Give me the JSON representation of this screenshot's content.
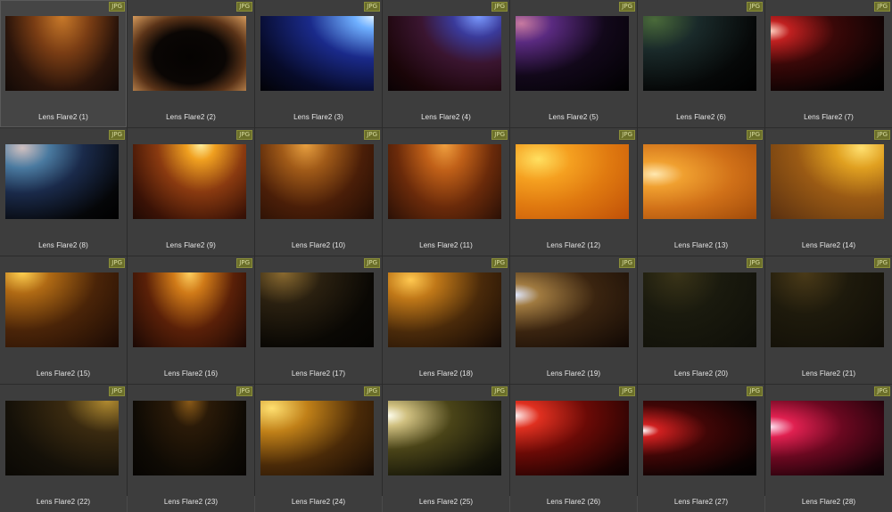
{
  "file_type_badge": "JPG",
  "items": [
    {
      "label": "Lens Flare2 (1)",
      "bg": "radial-gradient(ellipse at 50% 0%, #c97a2a 0%, #7a3d14 35%, #2a140a 70%, #120906 100%)"
    },
    {
      "label": "Lens Flare2 (2)",
      "bg": "radial-gradient(ellipse at 50% 55%, #050302 0%, #0a0604 45%, #5a3318 70%, #d59a5c 100%)"
    },
    {
      "label": "Lens Flare2 (3)",
      "bg": "radial-gradient(ellipse at 100% 0%, #dff0ff 0%, #6fb0ff 12%, #1a2a8a 40%, #070b2a 75%, #020206 100%)"
    },
    {
      "label": "Lens Flare2 (4)",
      "bg": "radial-gradient(ellipse at 80% 0%, #7a9aff 0%, #3a3a9a 20%, #3a1530 45%, #1a0508 80%, #0a0204 100%)"
    },
    {
      "label": "Lens Flare2 (5)",
      "bg": "radial-gradient(ellipse at 5% 10%, #c87aa0 0%, #5a2a80 20%, #12081a 55%, #000 100%)"
    },
    {
      "label": "Lens Flare2 (6)",
      "bg": "radial-gradient(ellipse at 10% 5%, #4a6a3a 0%, #1a2a2a 30%, #060808 70%, #000 100%)"
    },
    {
      "label": "Lens Flare2 (7)",
      "bg": "radial-gradient(ellipse at 0% 20%, #ffd0c0 0%, #c02020 12%, #3a0808 40%, #060202 80%, #000 100%)"
    },
    {
      "label": "Lens Flare2 (8)",
      "bg": "radial-gradient(ellipse at 15% 5%, #d0c0c0 0%, #4a7aa0 20%, #1a2a4a 45%, #050608 80%, #000 100%)"
    },
    {
      "label": "Lens Flare2 (9)",
      "bg": "radial-gradient(ellipse at 60% 0%, #fff0a0 0%, #f0a020 15%, #8a3a10 45%, #3a1206 80%, #200a04 100%)"
    },
    {
      "label": "Lens Flare2 (10)",
      "bg": "radial-gradient(ellipse at 40% 0%, #e8a040 0%, #a05a18 25%, #4a1e08 60%, #200c04 100%)"
    },
    {
      "label": "Lens Flare2 (11)",
      "bg": "radial-gradient(ellipse at 50% 0%, #f0a040 0%, #c06018 25%, #6a2a0a 60%, #2a1006 100%)"
    },
    {
      "label": "Lens Flare2 (12)",
      "bg": "radial-gradient(ellipse at 20% 20%, #ffe060 0%, #f5a020 25%, #e07a10 55%, #c05008 100%)"
    },
    {
      "label": "Lens Flare2 (13)",
      "bg": "radial-gradient(ellipse at 10% 40%, #ffe8b0 0%, #f0a030 20%, #d07018 55%, #a04a0a 100%)"
    },
    {
      "label": "Lens Flare2 (14)",
      "bg": "radial-gradient(ellipse at 80% 5%, #ffe070 0%, #e0a020 20%, #9a5a14 50%, #5a3010 100%)"
    },
    {
      "label": "Lens Flare2 (15)",
      "bg": "radial-gradient(ellipse at 15% 0%, #ffd050 0%, #b06a14 20%, #4a2408 55%, #1a0a04 100%)"
    },
    {
      "label": "Lens Flare2 (16)",
      "bg": "radial-gradient(ellipse at 50% 0%, #ffd060 0%, #d07a18 20%, #5a2008 55%, #1a0804 100%)"
    },
    {
      "label": "Lens Flare2 (17)",
      "bg": "radial-gradient(ellipse at 20% 0%, #8a6a30 0%, #2a2010 30%, #0a0804 70%, #050402 100%)"
    },
    {
      "label": "Lens Flare2 (18)",
      "bg": "radial-gradient(ellipse at 20% 10%, #ffc850 0%, #c07818 20%, #4a2a0a 55%, #120804 100%)"
    },
    {
      "label": "Lens Flare2 (19)",
      "bg": "radial-gradient(ellipse at 0% 30%, #e0e8ff 0%, #a07a40 15%, #3a2410 50%, #100804 100%)"
    },
    {
      "label": "Lens Flare2 (20)",
      "bg": "radial-gradient(ellipse at 30% 0%, #3a3418 0%, #1a1a0e 40%, #0e0e08 100%)"
    },
    {
      "label": "Lens Flare2 (21)",
      "bg": "radial-gradient(ellipse at 30% 0%, #4a3a18 0%, #1e1a0c 40%, #0e0c06 100%)"
    },
    {
      "label": "Lens Flare2 (22)",
      "bg": "radial-gradient(ellipse at 90% 0%, #b08a30 0%, #3a2a10 30%, #141008 70%, #0a0804 100%)"
    },
    {
      "label": "Lens Flare2 (23)",
      "bg": "radial-gradient(ellipse at 50% 0%, #8a5a18 0%, #2a1a08 25%, #0e0a04 70%, #060402 100%)"
    },
    {
      "label": "Lens Flare2 (24)",
      "bg": "radial-gradient(ellipse at 10% 10%, #ffe070 0%, #c08018 25%, #4a2a08 60%, #140a04 100%)"
    },
    {
      "label": "Lens Flare2 (25)",
      "bg": "radial-gradient(ellipse at 0% 20%, #fffff0 0%, #d0c080 12%, #4a4418 40%, #141408 80%, #080804 100%)"
    },
    {
      "label": "Lens Flare2 (26)",
      "bg": "radial-gradient(ellipse at 0% 20%, #fff0f0 0%, #e03020 15%, #6a0a06 45%, #1a0202 85%, #0a0000 100%)"
    },
    {
      "label": "Lens Flare2 (27)",
      "bg": "radial-gradient(ellipse at 0% 40%, #ffffff 0%, #d02020 10%, #400606 40%, #0a0202 80%, #000 100%)"
    },
    {
      "label": "Lens Flare2 (28)",
      "bg": "radial-gradient(ellipse at 0% 35%, #ffe0f0 0%, #e02050 15%, #6a0820 45%, #1a0208 85%, #0a0004 100%)"
    }
  ]
}
